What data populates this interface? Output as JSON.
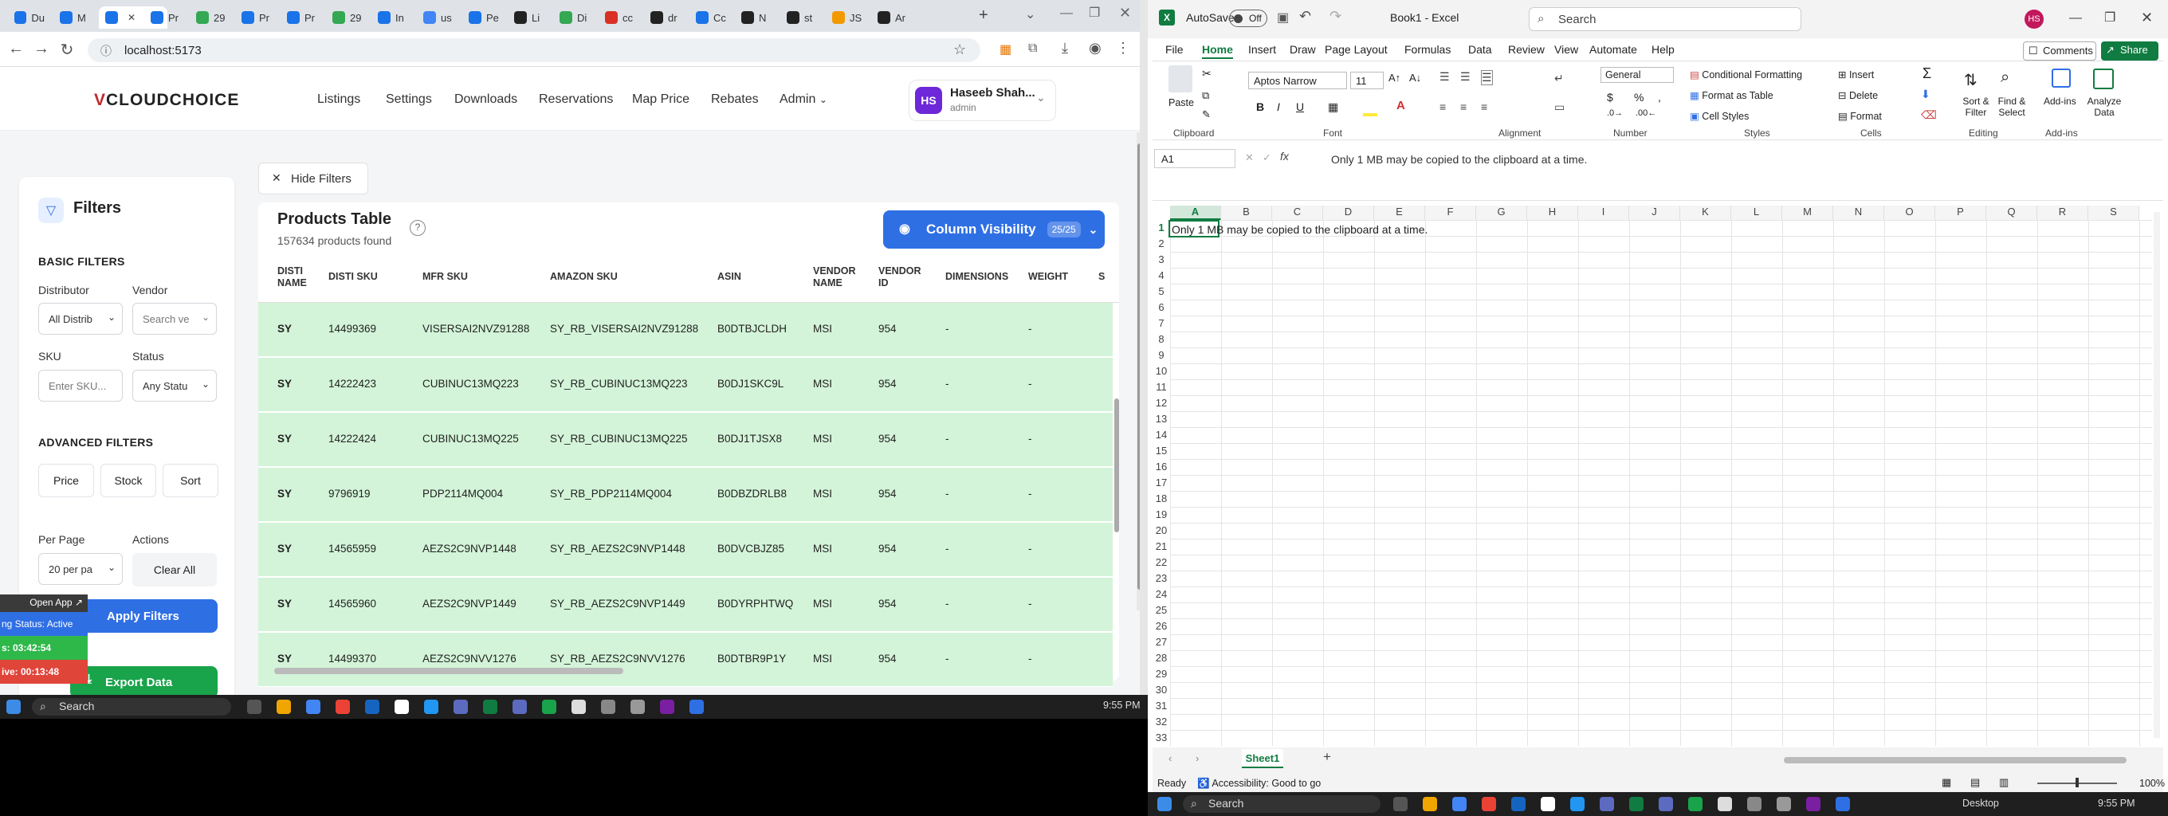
{
  "browser": {
    "tabs": [
      {
        "label": "Du",
        "color": "#1a73e8"
      },
      {
        "label": "M",
        "color": "#1a73e8"
      },
      {
        "label": "",
        "color": "#1a73e8"
      },
      {
        "label": "Pr",
        "color": "#1a73e8"
      },
      {
        "label": "29",
        "color": "#34a853"
      },
      {
        "label": "Pr",
        "color": "#1a73e8"
      },
      {
        "label": "Pr",
        "color": "#1a73e8"
      },
      {
        "label": "29",
        "color": "#34a853"
      },
      {
        "label": "In",
        "color": "#1a73e8"
      },
      {
        "label": "us",
        "color": "#4285f4"
      },
      {
        "label": "Pe",
        "color": "#1a73e8"
      },
      {
        "label": "Li",
        "color": "#222"
      },
      {
        "label": "Di",
        "color": "#34a853"
      },
      {
        "label": "cc",
        "color": "#d93025"
      },
      {
        "label": "dr",
        "color": "#222"
      },
      {
        "label": "Cc",
        "color": "#1a73e8"
      },
      {
        "label": "N",
        "color": "#222"
      },
      {
        "label": "st",
        "color": "#222"
      },
      {
        "label": "JS",
        "color": "#f29900"
      },
      {
        "label": "Ar",
        "color": "#222"
      }
    ],
    "url": "localhost:5173"
  },
  "app": {
    "logo_v": "V",
    "logo_rest": "CLOUDCHOICE",
    "nav": [
      "Listings",
      "Settings",
      "Downloads",
      "Reservations",
      "Map Price",
      "Rebates",
      "Admin"
    ],
    "user": {
      "initials": "HS",
      "name": "Haseeb Shah...",
      "role": "admin"
    }
  },
  "filters": {
    "title": "Filters",
    "basic_label": "BASIC FILTERS",
    "distributor_label": "Distributor",
    "distributor_value": "All Distrib",
    "vendor_label": "Vendor",
    "vendor_placeholder": "Search ve",
    "sku_label": "SKU",
    "sku_placeholder": "Enter SKU...",
    "status_label": "Status",
    "status_value": "Any Statu",
    "advanced_label": "ADVANCED FILTERS",
    "price_btn": "Price",
    "stock_btn": "Stock",
    "sort_btn": "Sort",
    "per_page_label": "Per Page",
    "per_page_value": "20 per pa",
    "actions_label": "Actions",
    "clear_all": "Clear All",
    "apply": "Apply Filters",
    "export": "Export Data"
  },
  "widget": {
    "open_app": "Open App",
    "status": "ng Status: Active",
    "timer1": "s: 03:42:54",
    "timer2": "ive: 00:13:48"
  },
  "table": {
    "hide_filters": "Hide Filters",
    "title": "Products Table",
    "count": "157634 products found",
    "column_visibility": "Column Visibility",
    "col_badge": "25/25",
    "headers": [
      "DISTI NAME",
      "DISTI SKU",
      "MFR SKU",
      "AMAZON SKU",
      "ASIN",
      "VENDOR NAME",
      "VENDOR ID",
      "DIMENSIONS",
      "WEIGHT",
      "S"
    ],
    "rows": [
      [
        "SY",
        "14499369",
        "VISERSAI2NVZ91288",
        "SY_RB_VISERSAI2NVZ91288",
        "B0DTBJCLDH",
        "MSI",
        "954",
        "-",
        "-"
      ],
      [
        "SY",
        "14222423",
        "CUBINUC13MQ223",
        "SY_RB_CUBINUC13MQ223",
        "B0DJ1SKC9L",
        "MSI",
        "954",
        "-",
        "-"
      ],
      [
        "SY",
        "14222424",
        "CUBINUC13MQ225",
        "SY_RB_CUBINUC13MQ225",
        "B0DJ1TJSX8",
        "MSI",
        "954",
        "-",
        "-"
      ],
      [
        "SY",
        "9796919",
        "PDP2114MQ004",
        "SY_RB_PDP2114MQ004",
        "B0DBZDRLB8",
        "MSI",
        "954",
        "-",
        "-"
      ],
      [
        "SY",
        "14565959",
        "AEZS2C9NVP1448",
        "SY_RB_AEZS2C9NVP1448",
        "B0DVCBJZ85",
        "MSI",
        "954",
        "-",
        "-"
      ],
      [
        "SY",
        "14565960",
        "AEZS2C9NVP1449",
        "SY_RB_AEZS2C9NVP1449",
        "B0DYRPHTWQ",
        "MSI",
        "954",
        "-",
        "-"
      ],
      [
        "SY",
        "14499370",
        "AEZS2C9NVV1276",
        "SY_RB_AEZS2C9NVV1276",
        "B0DTBR9P1Y",
        "MSI",
        "954",
        "-",
        "-"
      ]
    ]
  },
  "taskbar_left": {
    "search": "Search",
    "time": "9:55 PM"
  },
  "excel": {
    "autosave": "AutoSave",
    "autosave_state": "Off",
    "doc_title": "Book1 - Excel",
    "search": "Search",
    "user_initials": "HS",
    "menus": [
      "File",
      "Home",
      "Insert",
      "Draw",
      "Page Layout",
      "Formulas",
      "Data",
      "Review",
      "View",
      "Automate",
      "Help"
    ],
    "comments": "Comments",
    "share": "Share",
    "font_name": "Aptos Narrow",
    "font_size": "11",
    "number_format": "General",
    "ribbon_items": {
      "paste": "Paste",
      "cond_format": "Conditional Formatting",
      "format_table": "Format as Table",
      "cell_styles": "Cell Styles",
      "insert": "Insert",
      "delete": "Delete",
      "format": "Format",
      "sort_filter": "Sort & Filter",
      "find_select": "Find & Select",
      "addins": "Add-ins",
      "analyze": "Analyze Data"
    },
    "groups": [
      "Clipboard",
      "Font",
      "Alignment",
      "Number",
      "Styles",
      "Cells",
      "Editing",
      "Add-ins"
    ],
    "name_box": "A1",
    "formula": "Only 1 MB may be copied to the clipboard at a time.",
    "columns": [
      "A",
      "B",
      "C",
      "D",
      "E",
      "F",
      "G",
      "H",
      "I",
      "J",
      "K",
      "L",
      "M",
      "N",
      "O",
      "P",
      "Q",
      "R",
      "S"
    ],
    "a1": "Only 1 MB may be copied to the clipboard at a time.",
    "sheet": "Sheet1",
    "status_ready": "Ready",
    "accessibility": "Accessibility: Good to go",
    "zoom": "100%"
  },
  "taskbar_right": {
    "search": "Search",
    "desktop": "Desktop",
    "time": "9:55 PM"
  }
}
